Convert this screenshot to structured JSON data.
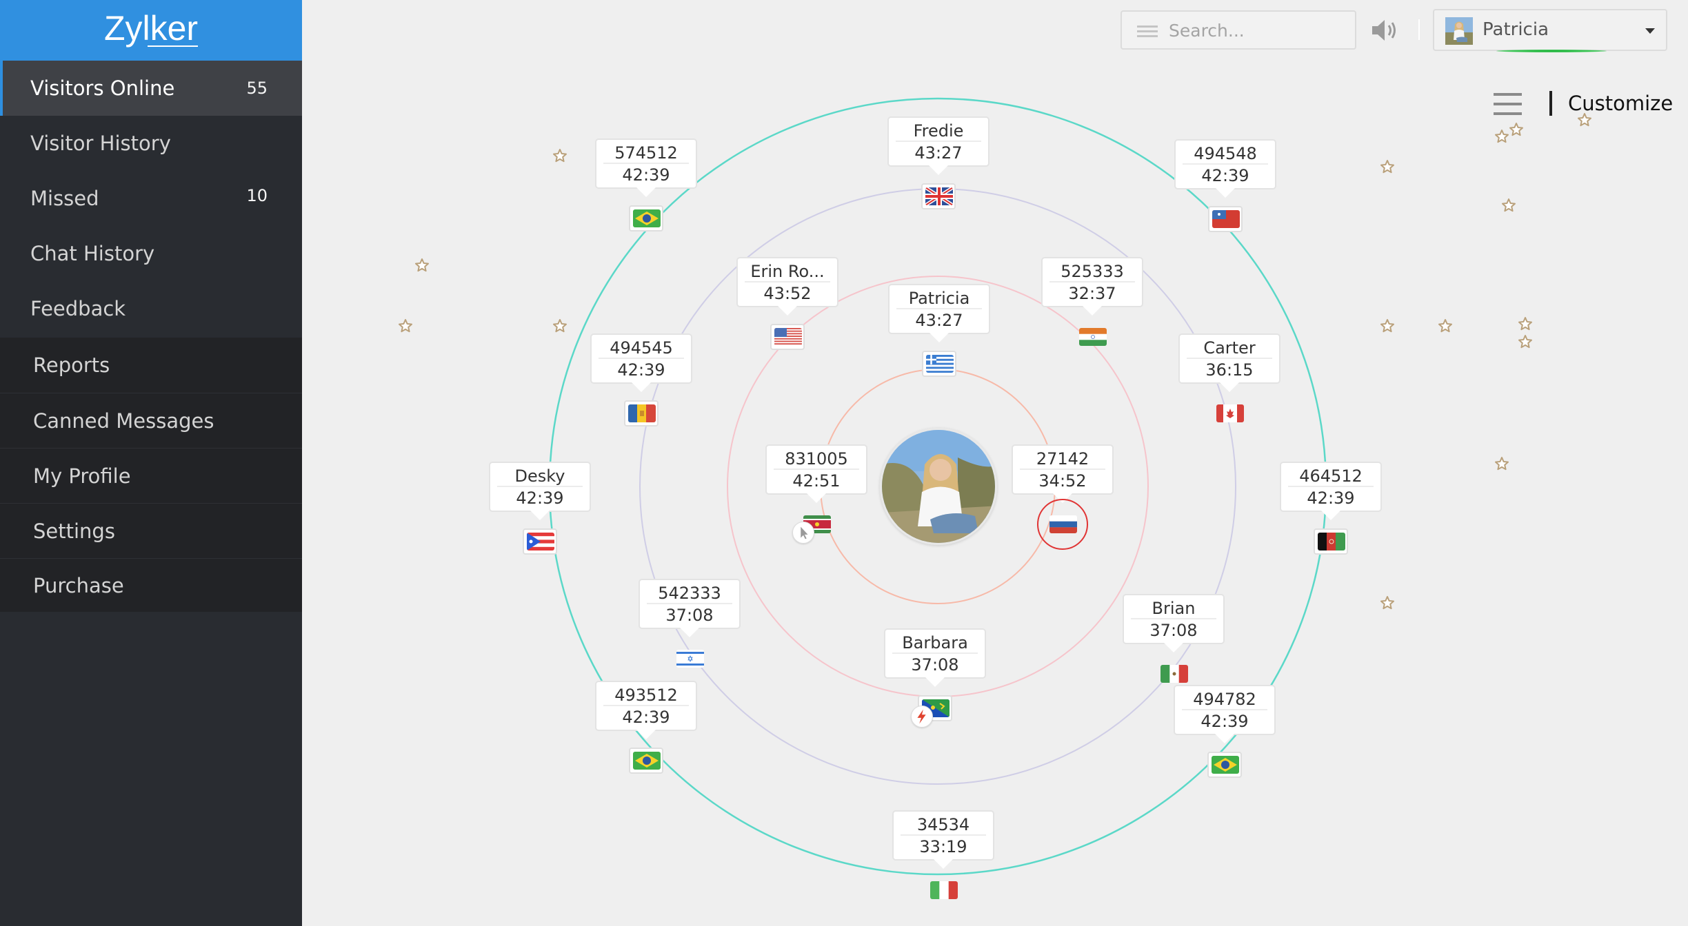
{
  "app": {
    "brand": "Zylker"
  },
  "sidebar": {
    "items": [
      {
        "label": "Visitors Online",
        "badge": "55",
        "active": true
      },
      {
        "label": "Visitor History",
        "badge": ""
      },
      {
        "label": "Missed",
        "badge": "10"
      },
      {
        "label": "Chat History",
        "badge": ""
      },
      {
        "label": "Feedback",
        "badge": ""
      },
      {
        "label": "Reports",
        "badge": ""
      },
      {
        "label": "Canned Messages",
        "badge": ""
      },
      {
        "label": "My Profile",
        "badge": ""
      },
      {
        "label": "Settings",
        "badge": ""
      },
      {
        "label": "Purchase",
        "badge": ""
      }
    ]
  },
  "topbar": {
    "search_placeholder": "Search...",
    "search_value": "",
    "operator_name": "Patricia",
    "operator_status": "online",
    "status_color": "#2bb845",
    "customize_label": "Customize",
    "icons": [
      "menu-icon",
      "speaker-icon",
      "chevron-down-icon",
      "hamburger-icon"
    ]
  },
  "orbit": {
    "center_operator": "Patricia",
    "ring_colors": [
      "#f7b9a8",
      "#f6c4cb",
      "#cfcde6",
      "#5bd8c8"
    ],
    "visitors": [
      {
        "label": "574512",
        "time": "42:39",
        "country": "Brazil",
        "flag": "br"
      },
      {
        "label": "Fredie",
        "time": "43:27",
        "country": "United Kingdom",
        "flag": "gb"
      },
      {
        "label": "494548",
        "time": "42:39",
        "country": "Samoa",
        "flag": "ws"
      },
      {
        "label": "Erin Ro...",
        "time": "43:52",
        "country": "United States",
        "flag": "us"
      },
      {
        "label": "525333",
        "time": "32:37",
        "country": "India",
        "flag": "in"
      },
      {
        "label": "Patricia",
        "time": "43:27",
        "country": "Greece",
        "flag": "gr"
      },
      {
        "label": "494545",
        "time": "42:39",
        "country": "Andorra",
        "flag": "ad"
      },
      {
        "label": "Carter",
        "time": "36:15",
        "country": "Canada",
        "flag": "ca"
      },
      {
        "label": "Desky",
        "time": "42:39",
        "country": "Puerto Rico",
        "flag": "pr"
      },
      {
        "label": "831005",
        "time": "42:51",
        "country": "Suriname",
        "flag": "sr",
        "badge": "cursor-icon"
      },
      {
        "label": "27142",
        "time": "34:52",
        "country": "Russia",
        "flag": "ru",
        "highlighted": true
      },
      {
        "label": "464512",
        "time": "42:39",
        "country": "Afghanistan",
        "flag": "af"
      },
      {
        "label": "542333",
        "time": "37:08",
        "country": "Israel",
        "flag": "il"
      },
      {
        "label": "Barbara",
        "time": "37:08",
        "country": "Christmas Island",
        "flag": "cx",
        "badge": "lightning-icon"
      },
      {
        "label": "Brian",
        "time": "37:08",
        "country": "Mexico",
        "flag": "mx"
      },
      {
        "label": "493512",
        "time": "42:39",
        "country": "Brazil",
        "flag": "br"
      },
      {
        "label": "494782",
        "time": "42:39",
        "country": "Brazil",
        "flag": "br"
      },
      {
        "label": "34534",
        "time": "33:19",
        "country": "Italy",
        "flag": "it"
      }
    ]
  }
}
